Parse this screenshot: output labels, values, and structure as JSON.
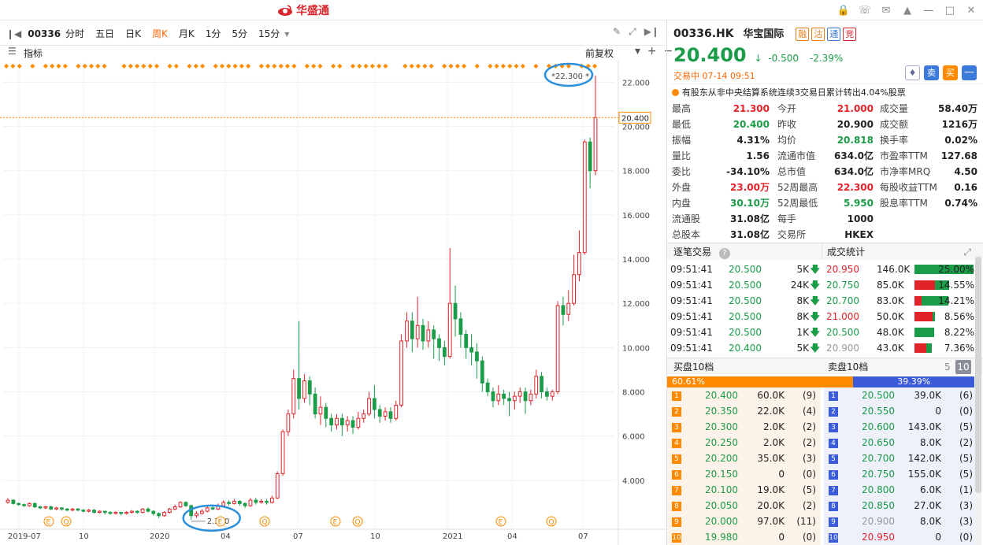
{
  "app": {
    "brand": "华盛通"
  },
  "toolbar": {
    "code": "00336",
    "tabs": [
      "分时",
      "五日",
      "日K",
      "周K",
      "月K",
      "1分",
      "5分",
      "15分"
    ],
    "active_tab": "周K"
  },
  "indicator_label": "指标",
  "adjust_label": "前复权",
  "colors": {
    "up": "#e2232a",
    "down": "#1a9c48",
    "accent": "#ff6600",
    "dot": "#ff8c00"
  },
  "chart_data": {
    "type": "candlestick",
    "x_ticks": [
      "2019-07",
      "10",
      "2020",
      "04",
      "07",
      "10",
      "2021",
      "04",
      "07"
    ],
    "y_ticks": [
      "22.000",
      "20.000",
      "18.000",
      "16.000",
      "14.000",
      "12.000",
      "10.000",
      "8.000",
      "6.000",
      "4.000"
    ],
    "ylim": [
      2.0,
      22.3
    ],
    "current_price_label": "20.400",
    "high_annotation": "22.300",
    "low_annotation": "2.220",
    "event_markers": [
      "E",
      "Q",
      "E",
      "Q",
      "E",
      "Q",
      "E",
      "Q"
    ],
    "candles": [
      [
        3.0,
        3.1,
        2.95,
        3.2
      ],
      [
        3.1,
        2.95,
        2.9,
        3.15
      ],
      [
        2.95,
        2.9,
        2.85,
        3.0
      ],
      [
        2.9,
        2.85,
        2.8,
        2.95
      ],
      [
        2.85,
        2.95,
        2.8,
        3.0
      ],
      [
        2.95,
        2.8,
        2.75,
        3.0
      ],
      [
        2.8,
        2.75,
        2.7,
        2.85
      ],
      [
        2.75,
        2.8,
        2.7,
        2.85
      ],
      [
        2.8,
        2.7,
        2.65,
        2.85
      ],
      [
        2.7,
        2.75,
        2.65,
        2.8
      ],
      [
        2.75,
        2.7,
        2.62,
        2.78
      ],
      [
        2.7,
        2.65,
        2.6,
        2.75
      ],
      [
        2.65,
        2.7,
        2.6,
        2.75
      ],
      [
        2.7,
        2.65,
        2.6,
        2.75
      ],
      [
        2.65,
        2.6,
        2.55,
        2.7
      ],
      [
        2.6,
        2.65,
        2.55,
        2.7
      ],
      [
        2.65,
        2.55,
        2.5,
        2.7
      ],
      [
        2.55,
        2.6,
        2.5,
        2.65
      ],
      [
        2.6,
        2.55,
        2.45,
        2.62
      ],
      [
        2.55,
        2.5,
        2.45,
        2.6
      ],
      [
        2.5,
        2.55,
        2.45,
        2.6
      ],
      [
        2.55,
        2.5,
        2.42,
        2.58
      ],
      [
        2.5,
        2.55,
        2.45,
        2.6
      ],
      [
        2.55,
        2.6,
        2.5,
        2.65
      ],
      [
        2.6,
        2.55,
        2.48,
        2.65
      ],
      [
        2.55,
        2.7,
        2.5,
        2.75
      ],
      [
        2.7,
        2.6,
        2.55,
        2.78
      ],
      [
        2.6,
        2.5,
        2.4,
        2.65
      ],
      [
        2.5,
        2.4,
        2.3,
        2.55
      ],
      [
        2.4,
        2.55,
        2.35,
        2.6
      ],
      [
        2.55,
        2.7,
        2.5,
        2.75
      ],
      [
        2.7,
        2.8,
        2.65,
        2.9
      ],
      [
        2.8,
        3.0,
        2.75,
        3.05
      ],
      [
        3.0,
        2.85,
        2.8,
        3.05
      ],
      [
        2.85,
        2.4,
        2.22,
        2.9
      ],
      [
        2.4,
        2.5,
        2.3,
        2.6
      ],
      [
        2.5,
        2.6,
        2.45,
        2.7
      ],
      [
        2.6,
        2.75,
        2.55,
        2.85
      ],
      [
        2.75,
        2.7,
        2.65,
        2.85
      ],
      [
        2.7,
        2.85,
        2.65,
        2.95
      ],
      [
        2.85,
        3.0,
        2.8,
        3.1
      ],
      [
        3.0,
        2.95,
        2.85,
        3.1
      ],
      [
        2.95,
        3.05,
        2.9,
        3.15
      ],
      [
        3.05,
        2.95,
        2.85,
        3.1
      ],
      [
        2.95,
        2.85,
        2.75,
        3.0
      ],
      [
        2.85,
        3.1,
        2.8,
        3.2
      ],
      [
        3.1,
        3.0,
        2.9,
        3.2
      ],
      [
        3.0,
        3.05,
        2.95,
        3.15
      ],
      [
        3.05,
        3.0,
        2.9,
        3.15
      ],
      [
        3.0,
        3.2,
        2.95,
        3.3
      ],
      [
        3.2,
        4.3,
        3.15,
        4.4
      ],
      [
        4.3,
        6.2,
        4.2,
        6.3
      ],
      [
        6.2,
        7.0,
        6.0,
        7.2
      ],
      [
        7.0,
        8.6,
        6.8,
        9.0
      ],
      [
        8.6,
        7.7,
        7.2,
        11.2
      ],
      [
        7.7,
        8.5,
        7.5,
        8.8
      ],
      [
        8.5,
        7.9,
        7.4,
        8.7
      ],
      [
        7.9,
        7.0,
        6.8,
        8.2
      ],
      [
        7.0,
        7.3,
        6.5,
        7.8
      ],
      [
        7.3,
        6.8,
        6.4,
        7.5
      ],
      [
        6.8,
        6.5,
        6.2,
        7.0
      ],
      [
        6.5,
        6.8,
        6.3,
        7.0
      ],
      [
        6.8,
        6.5,
        6.0,
        7.0
      ],
      [
        6.5,
        6.7,
        6.2,
        6.9
      ],
      [
        6.7,
        6.4,
        6.1,
        6.9
      ],
      [
        6.4,
        6.8,
        6.3,
        7.1
      ],
      [
        6.8,
        7.0,
        6.6,
        7.2
      ],
      [
        7.0,
        7.7,
        6.9,
        8.0
      ],
      [
        7.7,
        7.2,
        6.8,
        8.3
      ],
      [
        7.2,
        6.9,
        6.6,
        7.4
      ],
      [
        6.9,
        7.1,
        6.7,
        7.3
      ],
      [
        7.1,
        6.8,
        6.6,
        7.3
      ],
      [
        6.8,
        7.4,
        6.7,
        7.6
      ],
      [
        7.4,
        10.3,
        7.3,
        10.6
      ],
      [
        10.3,
        11.2,
        10.0,
        11.6
      ],
      [
        11.2,
        10.4,
        9.8,
        11.6
      ],
      [
        10.4,
        11.0,
        10.0,
        12.3
      ],
      [
        11.0,
        10.3,
        9.9,
        11.3
      ],
      [
        10.3,
        10.8,
        10.0,
        11.2
      ],
      [
        10.8,
        10.4,
        9.5,
        11.0
      ],
      [
        10.4,
        10.0,
        9.4,
        10.6
      ],
      [
        10.0,
        9.6,
        9.2,
        10.3
      ],
      [
        9.6,
        12.0,
        9.5,
        14.5
      ],
      [
        12.0,
        11.3,
        10.5,
        12.8
      ],
      [
        11.3,
        10.6,
        10.0,
        11.6
      ],
      [
        10.6,
        10.0,
        9.5,
        10.8
      ],
      [
        10.0,
        9.8,
        9.2,
        10.6
      ],
      [
        9.8,
        9.4,
        8.6,
        10.2
      ],
      [
        9.4,
        8.4,
        8.0,
        9.6
      ],
      [
        8.4,
        8.0,
        7.8,
        8.6
      ],
      [
        8.0,
        7.6,
        7.3,
        8.2
      ],
      [
        7.6,
        7.9,
        7.4,
        8.3
      ],
      [
        7.9,
        7.7,
        7.4,
        8.1
      ],
      [
        7.7,
        7.6,
        6.9,
        8.0
      ],
      [
        7.6,
        7.8,
        7.2,
        8.0
      ],
      [
        7.8,
        8.0,
        7.5,
        8.2
      ],
      [
        8.0,
        7.6,
        7.0,
        8.2
      ],
      [
        7.6,
        7.9,
        7.4,
        8.1
      ],
      [
        7.9,
        8.7,
        7.7,
        9.0
      ],
      [
        8.7,
        8.0,
        7.7,
        8.9
      ],
      [
        8.0,
        7.8,
        7.6,
        8.2
      ],
      [
        7.8,
        8.0,
        7.6,
        8.1
      ],
      [
        8.0,
        11.9,
        7.9,
        12.1
      ],
      [
        11.9,
        11.5,
        11.0,
        12.3
      ],
      [
        11.5,
        12.0,
        11.2,
        12.6
      ],
      [
        12.0,
        13.3,
        11.9,
        14.2
      ],
      [
        13.3,
        14.3,
        13.0,
        15.3
      ],
      [
        14.3,
        19.3,
        14.2,
        19.4
      ],
      [
        19.3,
        18.0,
        17.2,
        19.5
      ],
      [
        18.0,
        20.4,
        17.8,
        22.3
      ]
    ]
  },
  "stock": {
    "code": "00336.HK",
    "name": "华宝国际",
    "tags": [
      "融",
      "沽",
      "通",
      "竞"
    ],
    "price": "20.400",
    "arrow": "↓",
    "change": "-0.500",
    "change_pct": "-2.39%",
    "status": "交易中 07-14 09:51",
    "notice": "有股东从非中央结算系统连续3交易日累计转出4.04%股票",
    "quick_buttons": [
      "卖",
      "买"
    ]
  },
  "quote_grid": [
    [
      {
        "k": "最高",
        "v": "21.300",
        "c": "red"
      },
      {
        "k": "今开",
        "v": "21.000",
        "c": "red"
      },
      {
        "k": "成交量",
        "v": "58.40万",
        "c": ""
      }
    ],
    [
      {
        "k": "最低",
        "v": "20.400",
        "c": "green"
      },
      {
        "k": "昨收",
        "v": "20.900",
        "c": ""
      },
      {
        "k": "成交额",
        "v": "1216万",
        "c": ""
      }
    ],
    [
      {
        "k": "振幅",
        "v": "4.31%",
        "c": ""
      },
      {
        "k": "均价",
        "v": "20.818",
        "c": "green"
      },
      {
        "k": "换手率",
        "v": "0.02%",
        "c": ""
      }
    ],
    [
      {
        "k": "量比",
        "v": "1.56",
        "c": ""
      },
      {
        "k": "流通市值",
        "v": "634.0亿",
        "c": ""
      },
      {
        "k": "市盈率TTM",
        "v": "127.68",
        "c": ""
      }
    ],
    [
      {
        "k": "委比",
        "v": "-34.10%",
        "c": ""
      },
      {
        "k": "总市值",
        "v": "634.0亿",
        "c": ""
      },
      {
        "k": "市净率MRQ",
        "v": "4.50",
        "c": ""
      }
    ],
    [
      {
        "k": "外盘",
        "v": "23.00万",
        "c": "red"
      },
      {
        "k": "52周最高",
        "v": "22.300",
        "c": "red"
      },
      {
        "k": "每股收益TTM",
        "v": "0.16",
        "c": ""
      }
    ],
    [
      {
        "k": "内盘",
        "v": "30.10万",
        "c": "green"
      },
      {
        "k": "52周最低",
        "v": "5.950",
        "c": "green"
      },
      {
        "k": "股息率TTM",
        "v": "0.74%",
        "c": ""
      }
    ],
    [
      {
        "k": "流通股",
        "v": "31.08亿",
        "c": ""
      },
      {
        "k": "每手",
        "v": "1000",
        "c": ""
      },
      {
        "k": "",
        "v": "",
        "c": ""
      }
    ],
    [
      {
        "k": "总股本",
        "v": "31.08亿",
        "c": ""
      },
      {
        "k": "交易所",
        "v": "HKEX",
        "c": ""
      },
      {
        "k": "",
        "v": "",
        "c": ""
      }
    ]
  ],
  "ticks": {
    "title": "逐笔交易",
    "rows": [
      {
        "time": "09:51:41",
        "price": "20.500",
        "vol": "5K"
      },
      {
        "time": "09:51:41",
        "price": "20.500",
        "vol": "24K"
      },
      {
        "time": "09:51:41",
        "price": "20.500",
        "vol": "8K"
      },
      {
        "time": "09:51:41",
        "price": "20.500",
        "vol": "8K"
      },
      {
        "time": "09:51:41",
        "price": "20.500",
        "vol": "1K"
      },
      {
        "time": "09:51:41",
        "price": "20.400",
        "vol": "5K"
      }
    ]
  },
  "stats": {
    "title": "成交统计",
    "rows": [
      {
        "price": "20.950",
        "vol": "146.0K",
        "pct": "25.00%",
        "frac": 0.25,
        "buy": 0.0,
        "c": "red"
      },
      {
        "price": "20.750",
        "vol": "85.0K",
        "pct": "14.55%",
        "frac": 0.1455,
        "buy": 0.6,
        "c": "green"
      },
      {
        "price": "20.700",
        "vol": "83.0K",
        "pct": "14.21%",
        "frac": 0.1421,
        "buy": 0.2,
        "c": "green"
      },
      {
        "price": "21.000",
        "vol": "50.0K",
        "pct": "8.56%",
        "frac": 0.0856,
        "buy": 0.9,
        "c": "red"
      },
      {
        "price": "20.500",
        "vol": "48.0K",
        "pct": "8.22%",
        "frac": 0.0822,
        "buy": 0.0,
        "c": "green"
      },
      {
        "price": "20.900",
        "vol": "43.0K",
        "pct": "7.36%",
        "frac": 0.0736,
        "buy": 0.7,
        "c": "gray"
      }
    ]
  },
  "book": {
    "bid_title": "买盘10档",
    "ask_title": "卖盘10档",
    "levels": [
      "5",
      "10"
    ],
    "bid_pct": "60.61%",
    "ask_pct": "39.39%",
    "bid_frac": 0.6061,
    "bids": [
      {
        "n": "1",
        "price": "20.400",
        "vol": "60.0K",
        "cnt": "(9)",
        "c": "green"
      },
      {
        "n": "2",
        "price": "20.350",
        "vol": "22.0K",
        "cnt": "(4)",
        "c": "green"
      },
      {
        "n": "3",
        "price": "20.300",
        "vol": "2.0K",
        "cnt": "(2)",
        "c": "green"
      },
      {
        "n": "4",
        "price": "20.250",
        "vol": "2.0K",
        "cnt": "(2)",
        "c": "green"
      },
      {
        "n": "5",
        "price": "20.200",
        "vol": "35.0K",
        "cnt": "(3)",
        "c": "green"
      },
      {
        "n": "6",
        "price": "20.150",
        "vol": "0",
        "cnt": "(0)",
        "c": "green"
      },
      {
        "n": "7",
        "price": "20.100",
        "vol": "19.0K",
        "cnt": "(5)",
        "c": "green"
      },
      {
        "n": "8",
        "price": "20.050",
        "vol": "20.0K",
        "cnt": "(2)",
        "c": "green"
      },
      {
        "n": "9",
        "price": "20.000",
        "vol": "97.0K",
        "cnt": "(11)",
        "c": "green"
      },
      {
        "n": "10",
        "price": "19.980",
        "vol": "0",
        "cnt": "(0)",
        "c": "green"
      }
    ],
    "asks": [
      {
        "n": "1",
        "price": "20.500",
        "vol": "39.0K",
        "cnt": "(6)",
        "c": "green"
      },
      {
        "n": "2",
        "price": "20.550",
        "vol": "0",
        "cnt": "(0)",
        "c": "green"
      },
      {
        "n": "3",
        "price": "20.600",
        "vol": "143.0K",
        "cnt": "(5)",
        "c": "green"
      },
      {
        "n": "4",
        "price": "20.650",
        "vol": "8.0K",
        "cnt": "(2)",
        "c": "green"
      },
      {
        "n": "5",
        "price": "20.700",
        "vol": "142.0K",
        "cnt": "(5)",
        "c": "green"
      },
      {
        "n": "6",
        "price": "20.750",
        "vol": "155.0K",
        "cnt": "(5)",
        "c": "green"
      },
      {
        "n": "7",
        "price": "20.800",
        "vol": "6.0K",
        "cnt": "(1)",
        "c": "green"
      },
      {
        "n": "8",
        "price": "20.850",
        "vol": "27.0K",
        "cnt": "(3)",
        "c": "green"
      },
      {
        "n": "9",
        "price": "20.900",
        "vol": "8.0K",
        "cnt": "(3)",
        "c": "gray"
      },
      {
        "n": "10",
        "price": "20.950",
        "vol": "0",
        "cnt": "(0)",
        "c": "red"
      }
    ]
  }
}
